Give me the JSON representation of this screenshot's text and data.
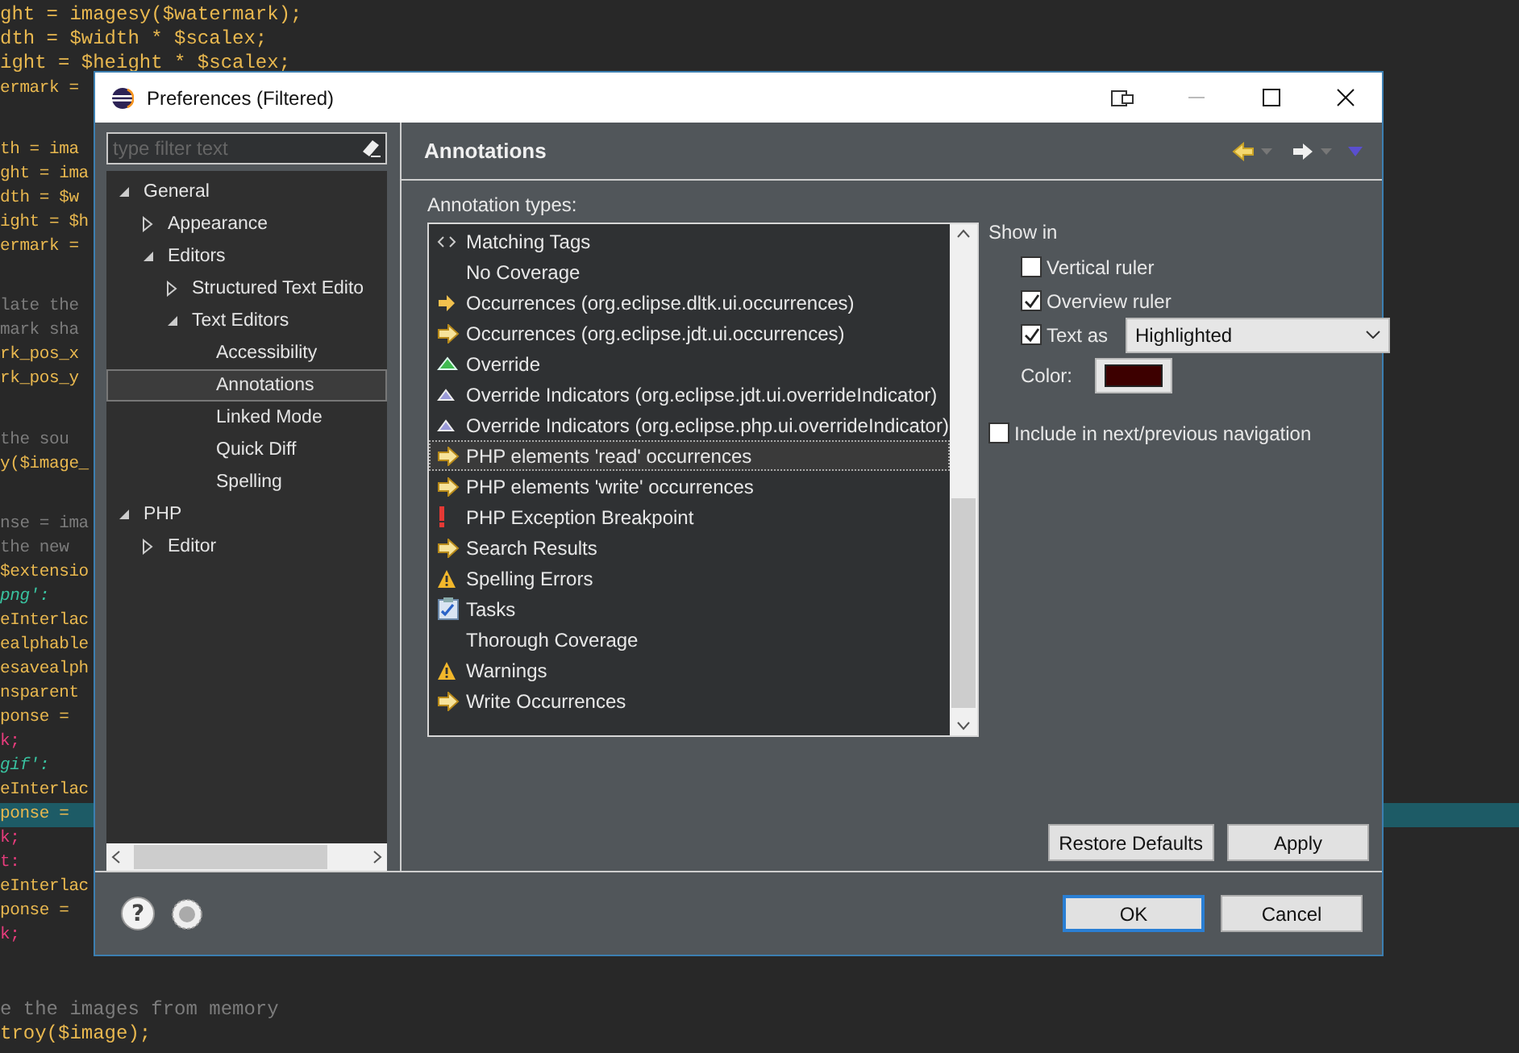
{
  "editor": {
    "top_lines": [
      {
        "text": "ght = imagesy($watermark);",
        "kind": "code"
      },
      {
        "text": "dth = $width * $scalex;",
        "kind": "code"
      },
      {
        "text": "ight = $height * $scalex;",
        "kind": "code"
      }
    ],
    "side_blocks": [
      [
        {
          "text": "ermark =",
          "kind": "code",
          "highlighted": false
        }
      ],
      [
        {
          "text": "th = ima",
          "kind": "code",
          "highlighted": false
        },
        {
          "text": "ght = ima",
          "kind": "code",
          "highlighted": false
        },
        {
          "text": "dth = $w",
          "kind": "code",
          "highlighted": false
        },
        {
          "text": "ight = $h",
          "kind": "code",
          "highlighted": false
        },
        {
          "text": "ermark =",
          "kind": "code",
          "highlighted": false
        }
      ],
      [
        {
          "text": "late the",
          "kind": "comment",
          "highlighted": false
        },
        {
          "text": "mark sha",
          "kind": "comment",
          "highlighted": false
        },
        {
          "text": "rk_pos_x",
          "kind": "code",
          "highlighted": false
        },
        {
          "text": "rk_pos_y",
          "kind": "code",
          "highlighted": false
        }
      ],
      [
        {
          "text": "the sou",
          "kind": "comment",
          "highlighted": false
        },
        {
          "text": "y($image_",
          "kind": "code",
          "highlighted": false
        }
      ],
      [
        {
          "text": "nse = ima",
          "kind": "comment",
          "highlighted": false
        },
        {
          "text": "the new",
          "kind": "comment",
          "highlighted": false
        },
        {
          "text": "$extensio",
          "kind": "code",
          "highlighted": false
        },
        {
          "text": "png':",
          "kind": "string",
          "highlighted": false
        },
        {
          "text": "eInterlac",
          "kind": "code",
          "highlighted": false
        },
        {
          "text": "ealphable",
          "kind": "code",
          "highlighted": false
        },
        {
          "text": "esavealph",
          "kind": "code",
          "highlighted": false
        },
        {
          "text": "nsparent",
          "kind": "code",
          "highlighted": false
        },
        {
          "text": "ponse =",
          "kind": "code",
          "highlighted": false
        },
        {
          "text": "k;",
          "kind": "keyword",
          "highlighted": false
        },
        {
          "text": "gif':",
          "kind": "string",
          "highlighted": false
        },
        {
          "text": "eInterlac",
          "kind": "code",
          "highlighted": false
        },
        {
          "text": "ponse =",
          "kind": "code",
          "highlighted": true
        },
        {
          "text": "k;",
          "kind": "keyword",
          "highlighted": false
        },
        {
          "text": "t:",
          "kind": "keyword",
          "highlighted": false
        },
        {
          "text": "eInterlac",
          "kind": "code",
          "highlighted": false
        },
        {
          "text": "ponse =",
          "kind": "code",
          "highlighted": false
        },
        {
          "text": "k;",
          "kind": "keyword",
          "highlighted": false
        }
      ]
    ],
    "bottom_lines": [
      {
        "text": "e the images from memory",
        "kind": "comment"
      },
      {
        "text": "troy($image);",
        "kind": "code"
      }
    ]
  },
  "window": {
    "title": "Preferences (Filtered)"
  },
  "filter": {
    "placeholder": "type filter text"
  },
  "tree": [
    {
      "label": "General",
      "expanded": true,
      "selected": false,
      "children": [
        {
          "label": "Appearance",
          "expanded": false,
          "selected": false
        },
        {
          "label": "Editors",
          "expanded": true,
          "selected": false,
          "children": [
            {
              "label": "Structured Text Edito",
              "expanded": false,
              "selected": false
            },
            {
              "label": "Text Editors",
              "expanded": true,
              "selected": false,
              "children": [
                {
                  "label": "Accessibility",
                  "selected": false
                },
                {
                  "label": "Annotations",
                  "selected": true
                },
                {
                  "label": "Linked Mode",
                  "selected": false
                },
                {
                  "label": "Quick Diff",
                  "selected": false
                },
                {
                  "label": "Spelling",
                  "selected": false
                }
              ]
            }
          ]
        }
      ]
    },
    {
      "label": "PHP",
      "expanded": true,
      "selected": false,
      "children": [
        {
          "label": "Editor",
          "expanded": false,
          "selected": false
        }
      ]
    }
  ],
  "page": {
    "title": "Annotations",
    "list_label": "Annotation types:"
  },
  "annotation_types": [
    {
      "label": "Matching Tags",
      "kind": "tags",
      "selected": false
    },
    {
      "label": "No Coverage",
      "kind": "none",
      "selected": false
    },
    {
      "label": "Occurrences (org.eclipse.dltk.ui.occurrences)",
      "kind": "arrow",
      "selected": false
    },
    {
      "label": "Occurrences (org.eclipse.jdt.ui.occurrences)",
      "kind": "arrowbox",
      "selected": false
    },
    {
      "label": "Override",
      "kind": "greentriangle",
      "selected": false
    },
    {
      "label": "Override Indicators (org.eclipse.jdt.ui.overrideIndicator)",
      "kind": "triangle",
      "selected": false
    },
    {
      "label": "Override Indicators (org.eclipse.php.ui.overrideIndicator)",
      "kind": "triangle",
      "selected": false
    },
    {
      "label": "PHP elements 'read' occurrences",
      "kind": "arrowbox",
      "selected": true
    },
    {
      "label": "PHP elements 'write' occurrences",
      "kind": "arrowbox",
      "selected": false
    },
    {
      "label": "PHP Exception Breakpoint",
      "kind": "error",
      "selected": false
    },
    {
      "label": "Search Results",
      "kind": "arrowbox",
      "selected": false
    },
    {
      "label": "Spelling Errors",
      "kind": "warning",
      "selected": false
    },
    {
      "label": "Tasks",
      "kind": "tasks",
      "selected": false
    },
    {
      "label": "Thorough Coverage",
      "kind": "none",
      "selected": false
    },
    {
      "label": "Warnings",
      "kind": "warning",
      "selected": false
    },
    {
      "label": "Write Occurrences",
      "kind": "arrowbox",
      "selected": false
    }
  ],
  "options": {
    "show_in": "Show in",
    "vertical_ruler": {
      "label": "Vertical ruler",
      "checked": false
    },
    "overview_ruler": {
      "label": "Overview ruler",
      "checked": true
    },
    "text_as": {
      "label": "Text as",
      "checked": true,
      "value": "Highlighted"
    },
    "color": {
      "label": "Color:",
      "color": "#3d0000"
    },
    "navigation": {
      "label": "Include in next/previous navigation",
      "checked": false
    }
  },
  "help_glyph": "?",
  "buttons": {
    "restore": "Restore Defaults",
    "apply": "Apply",
    "ok": "OK",
    "cancel": "Cancel"
  }
}
